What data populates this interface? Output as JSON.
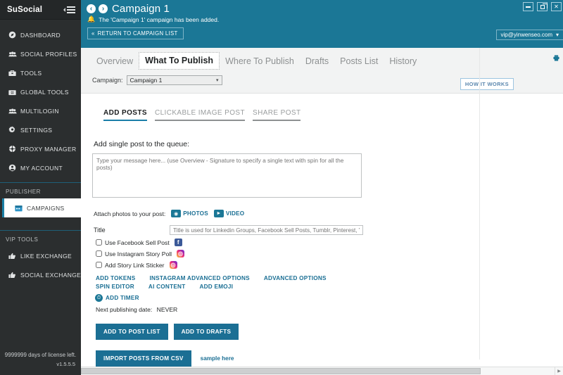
{
  "sidebar": {
    "brand": "SuSocial",
    "menu_icon": "hamburger-icon",
    "items": [
      {
        "label": "DASHBOARD",
        "icon": "compass-icon"
      },
      {
        "label": "SOCIAL PROFILES",
        "icon": "users-icon"
      },
      {
        "label": "TOOLS",
        "icon": "toolbox-icon"
      },
      {
        "label": "GLOBAL TOOLS",
        "icon": "globe-tools-icon"
      },
      {
        "label": "MULTILOGIN",
        "icon": "users-icon"
      },
      {
        "label": "SETTINGS",
        "icon": "gear-icon"
      },
      {
        "label": "PROXY MANAGER",
        "icon": "proxy-icon"
      },
      {
        "label": "MY ACCOUNT",
        "icon": "user-circle-icon"
      }
    ],
    "publisher_group": "PUBLISHER",
    "publisher_items": [
      {
        "label": "CAMPAIGNS",
        "icon": "calendar-icon",
        "active": true
      }
    ],
    "vip_group": "VIP TOOLS",
    "vip_items": [
      {
        "label": "LIKE EXCHANGE",
        "icon": "thumbs-up-icon"
      },
      {
        "label": "SOCIAL EXCHANGE",
        "icon": "thumbs-up-icon"
      }
    ],
    "license_text": "9999999 days of license left.",
    "version": "v1.5.5.5"
  },
  "topbar": {
    "back_icon": "arrow-left-circle-icon",
    "forward_icon": "arrow-right-circle-icon",
    "title": "Campaign 1",
    "alert_icon": "bell-icon",
    "alert_text": "The 'Campaign 1' campaign has been added.",
    "return_button": "RETURN TO CAMPAIGN LIST",
    "return_icon": "double-chevron-left-icon",
    "user_email": "vip@yinwenseo.com",
    "window_buttons": [
      "minimize",
      "restore",
      "close"
    ],
    "accent_color": "#1b7796"
  },
  "tabs": [
    {
      "label": "Overview",
      "active": false
    },
    {
      "label": "What To Publish",
      "active": true
    },
    {
      "label": "Where To Publish",
      "active": false
    },
    {
      "label": "Drafts",
      "active": false
    },
    {
      "label": "Posts List",
      "active": false
    },
    {
      "label": "History",
      "active": false
    }
  ],
  "campaign_selector": {
    "label": "Campaign:",
    "value": "Campaign 1",
    "chevron": "chevron-down-icon"
  },
  "how_it_works_button": "HOW IT WORKS",
  "printer_icon": "printer-icon",
  "subtabs": [
    {
      "label": "ADD POSTS",
      "active": true
    },
    {
      "label": "CLICKABLE IMAGE POST",
      "active": false
    },
    {
      "label": "SHARE POST",
      "active": false
    }
  ],
  "form": {
    "section_title": "Add single post to the queue:",
    "message_placeholder": "Type your message here... (use Overview - Signature to specify a single text with spin for all the posts)",
    "message_value": "",
    "attach_label": "Attach photos to your post:",
    "photos_button": "PHOTOS",
    "photos_icon": "camera-icon",
    "video_button": "VIDEO",
    "video_icon": "video-camera-icon",
    "title_label": "Title",
    "title_placeholder": "Title is used for Linkedin Groups, Facebook Sell Posts, Tumblr, Pinterest, Yo",
    "title_value": "",
    "checkboxes": [
      {
        "label": "Use Facebook Sell Post",
        "checked": false,
        "badge": "facebook-icon"
      },
      {
        "label": "Use Instagram Story Poll",
        "checked": false,
        "badge": "instagram-icon"
      },
      {
        "label": "Add Story Link Sticker",
        "checked": false,
        "badge": "instagram-icon"
      }
    ],
    "links_row1": [
      "ADD TOKENS",
      "INSTAGRAM ADVANCED OPTIONS",
      "ADVANCED OPTIONS"
    ],
    "links_row2": [
      "SPIN EDITOR",
      "AI CONTENT",
      "ADD EMOJI"
    ],
    "add_timer": "ADD TIMER",
    "timer_icon": "clock-icon",
    "next_publish_label": "Next publishing date:",
    "next_publish_value": "NEVER",
    "add_to_post_list": "ADD TO POST LIST",
    "add_to_drafts": "ADD TO DRAFTS",
    "import_csv": "IMPORT POSTS FROM CSV",
    "sample_link": "sample here"
  }
}
